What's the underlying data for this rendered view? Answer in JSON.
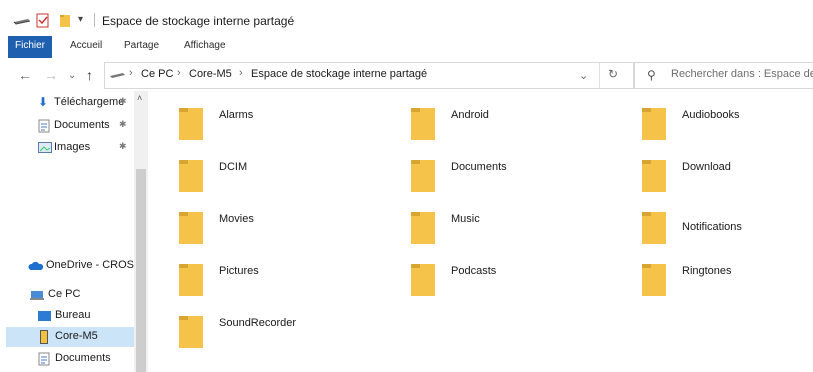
{
  "window": {
    "title": "Espace de stockage interne partagé"
  },
  "ribbon": {
    "tabs": [
      "Fichier",
      "Accueil",
      "Partage",
      "Affichage"
    ]
  },
  "address": {
    "crumbs": [
      "Ce PC",
      "Core-M5",
      "Espace de stockage interne partagé"
    ]
  },
  "search": {
    "placeholder": "Rechercher dans : Espace de s"
  },
  "nav": {
    "quick": [
      {
        "label": "Téléchargeme"
      },
      {
        "label": "Documents"
      },
      {
        "label": "Images"
      }
    ],
    "onedrive": "OneDrive - CROSS",
    "pc": "Ce PC",
    "pc_items": [
      "Bureau",
      "Core-M5",
      "Documents"
    ]
  },
  "folders": [
    "Alarms",
    "Android",
    "Audiobooks",
    "DCIM",
    "Documents",
    "Download",
    "Movies",
    "Music",
    "Notifications",
    "Pictures",
    "Podcasts",
    "Ringtones",
    "SoundRecorder"
  ],
  "colors": {
    "accent": "#1f5fb0",
    "folder": "#f5c24a",
    "selected": "#cce4f7"
  }
}
